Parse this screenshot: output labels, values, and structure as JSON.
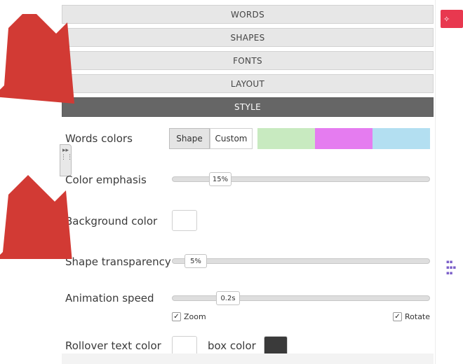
{
  "accordion": {
    "items": [
      {
        "label": "WORDS",
        "active": false
      },
      {
        "label": "SHAPES",
        "active": false
      },
      {
        "label": "FONTS",
        "active": false
      },
      {
        "label": "LAYOUT",
        "active": false
      },
      {
        "label": "STYLE",
        "active": true
      }
    ]
  },
  "style_panel": {
    "words_colors": {
      "label": "Words colors",
      "shape_button": "Shape",
      "custom_button": "Custom",
      "selected": "Shape",
      "swatches": [
        "#c8eac0",
        "#e57cf0",
        "#b3dff1"
      ]
    },
    "color_emphasis": {
      "label": "Color emphasis",
      "value": "15%",
      "fraction": 0.15
    },
    "background_color": {
      "label": "Background color",
      "color": "#ffffff"
    },
    "shape_transparency": {
      "label": "Shape transparency",
      "value": "5%",
      "fraction": 0.05
    },
    "animation_speed": {
      "label": "Animation speed",
      "value": "0.2s",
      "zoom_label": "Zoom",
      "zoom_checked": true,
      "rotate_label": "Rotate",
      "rotate_checked": true
    },
    "rollover": {
      "label": "Rollover text color",
      "text_color": "#ffffff",
      "box_label": "box color",
      "box_color": "#3a3a3a"
    }
  },
  "colors": {
    "arrow": "#d23a34",
    "active_header": "#666666",
    "accent_button": "#e8384f"
  },
  "icons": [
    "magic-wand-icon",
    "expand-arrows-icon",
    "grip-icon",
    "checkmark-icon",
    "arrow-annotation"
  ]
}
